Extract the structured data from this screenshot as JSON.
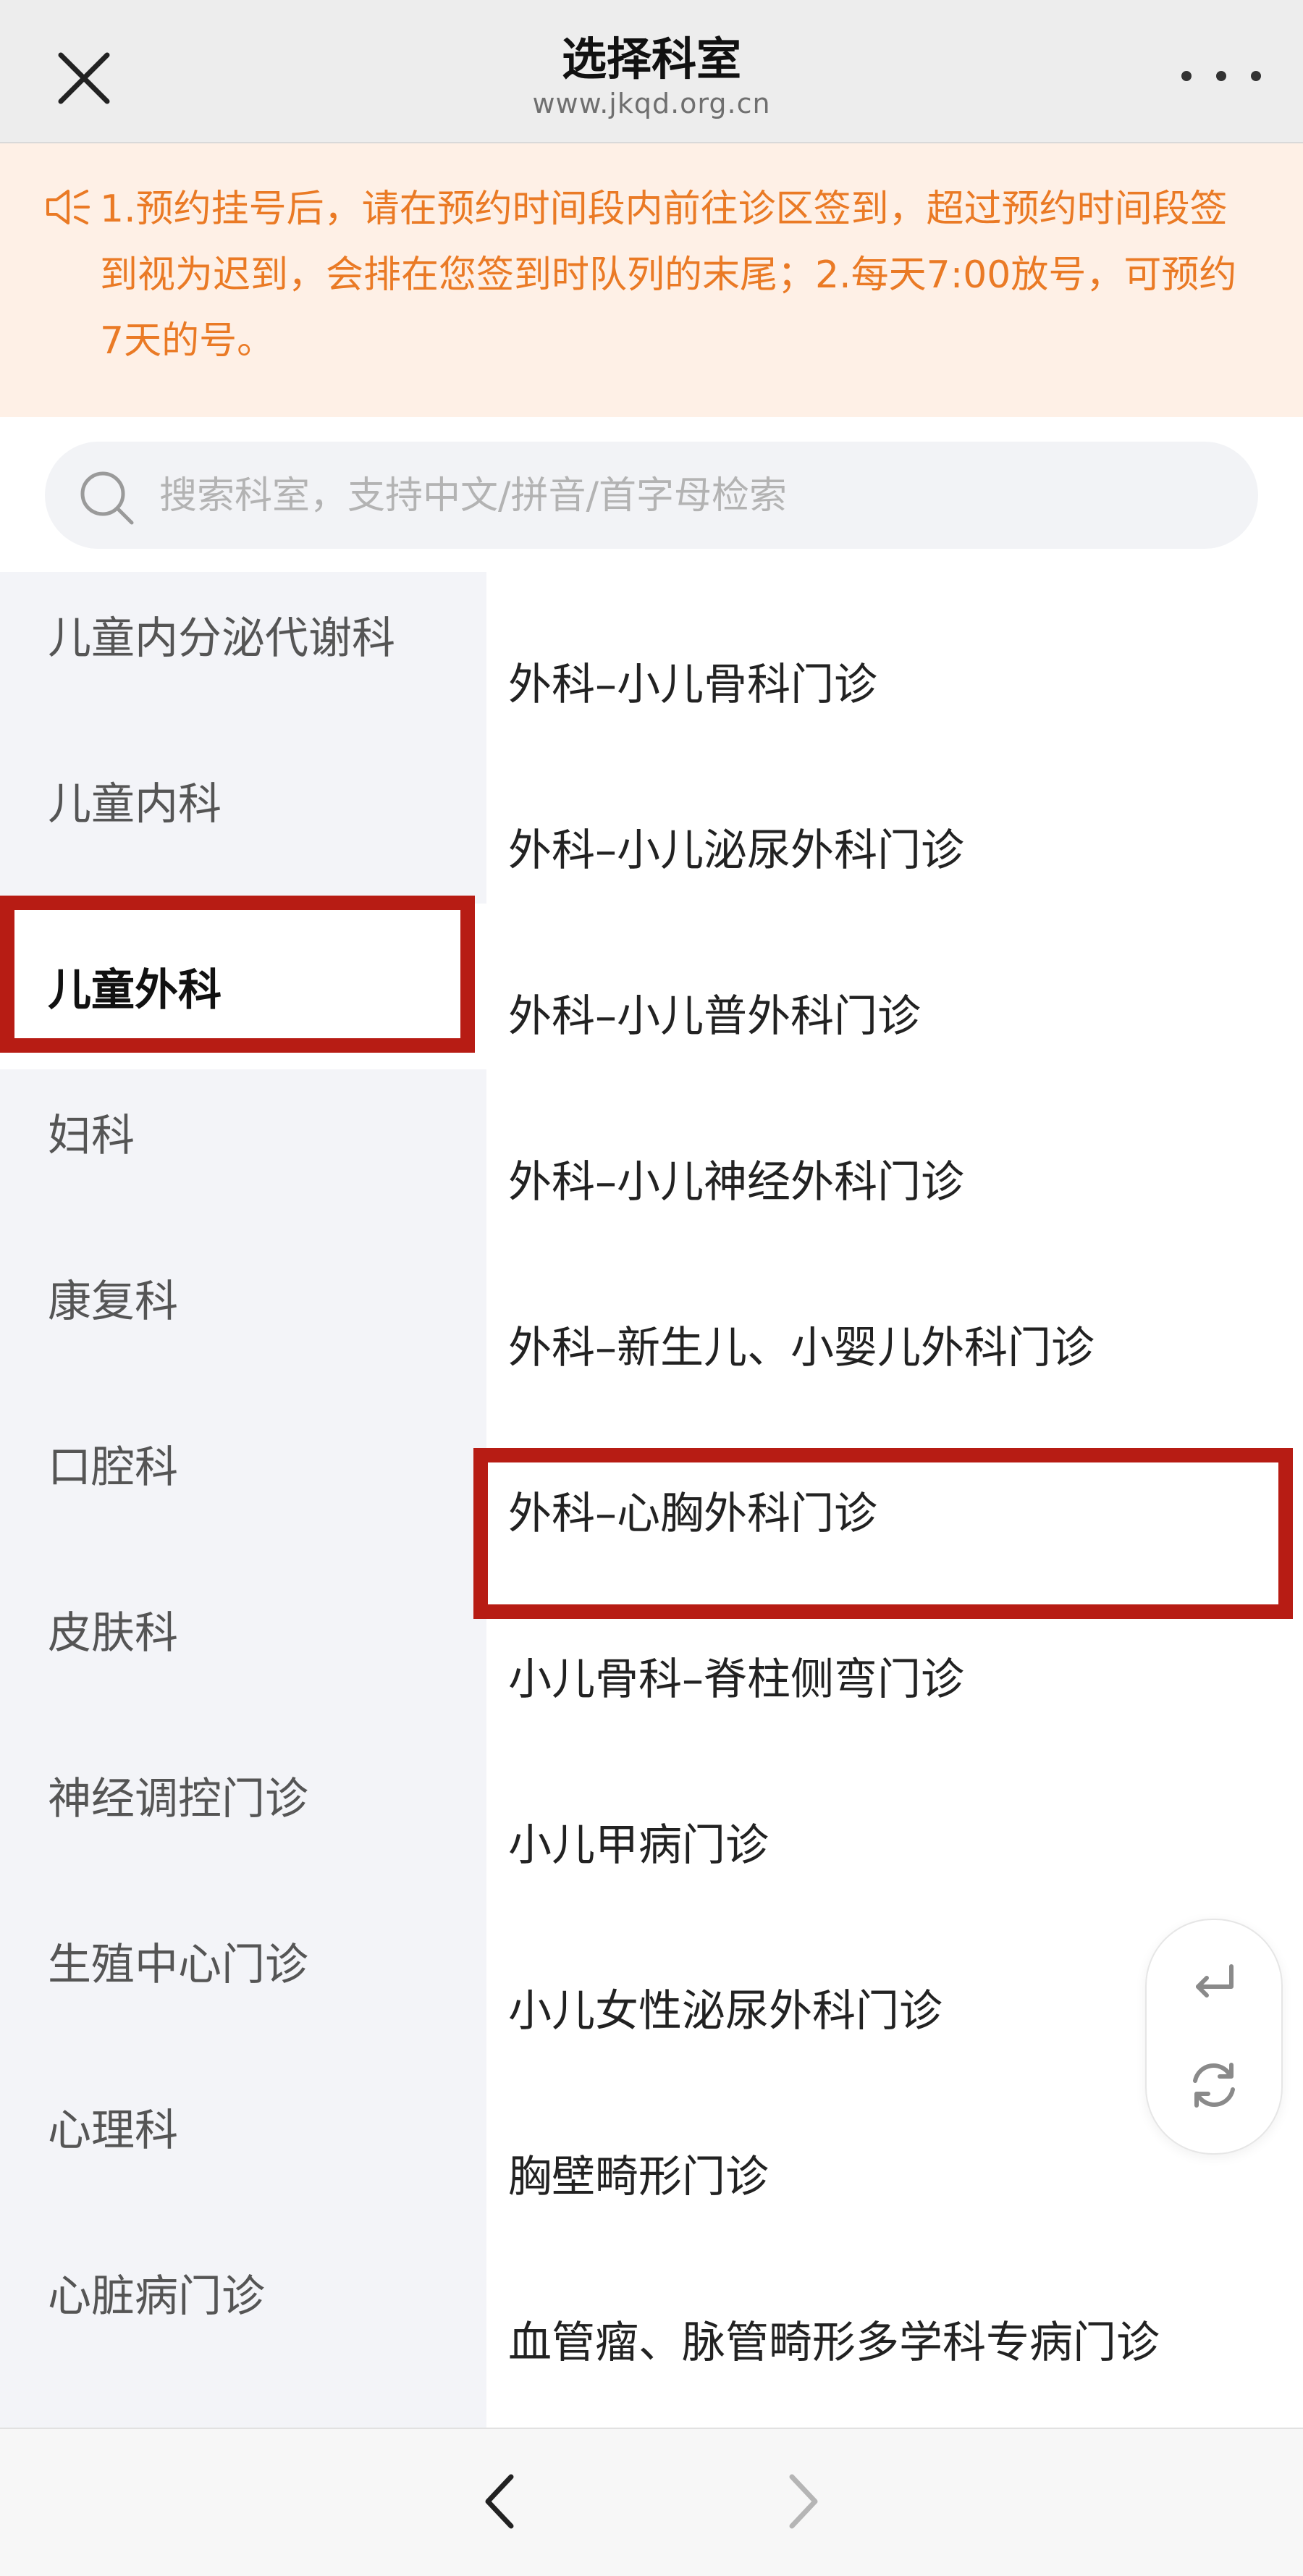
{
  "header": {
    "title": "选择科室",
    "url": "www.jkqd.org.cn",
    "close_icon": "close-icon",
    "more_icon": "more-dots-icon"
  },
  "notice": {
    "icon": "speaker-icon",
    "text": "1.预约挂号后，请在预约时间段内前往诊区签到，超过预约时间段签到视为迟到，会排在您签到时队列的末尾；2.每天7:00放号，可预约7天的号。",
    "color": "#ea7a25",
    "background": "#fef0e6"
  },
  "search": {
    "icon": "search-icon",
    "placeholder": "搜索科室，支持中文/拼音/首字母检索",
    "value": ""
  },
  "sidebar": {
    "selected": "儿童外科",
    "items": [
      {
        "label": "儿童内分泌代谢科"
      },
      {
        "label": "儿童内科"
      },
      {
        "label": "儿童外科"
      },
      {
        "label": "妇科"
      },
      {
        "label": "康复科"
      },
      {
        "label": "口腔科"
      },
      {
        "label": "皮肤科"
      },
      {
        "label": "神经调控门诊"
      },
      {
        "label": "生殖中心门诊"
      },
      {
        "label": "心理科"
      },
      {
        "label": "心脏病门诊"
      }
    ]
  },
  "departments": {
    "highlighted": "外科–心胸外科门诊",
    "items": [
      {
        "label": "外科–小儿骨科门诊"
      },
      {
        "label": "外科–小儿泌尿外科门诊"
      },
      {
        "label": "外科–小儿普外科门诊"
      },
      {
        "label": "外科–小儿神经外科门诊"
      },
      {
        "label": "外科–新生儿、小婴儿外科门诊"
      },
      {
        "label": "外科–心胸外科门诊"
      },
      {
        "label": "小儿骨科–脊柱侧弯门诊"
      },
      {
        "label": "小儿甲病门诊"
      },
      {
        "label": "小儿女性泌尿外科门诊"
      },
      {
        "label": "胸壁畸形门诊"
      },
      {
        "label": "血管瘤、脉管畸形多学科专病门诊"
      }
    ]
  },
  "floating_buttons": {
    "back_icon": "return-arrow-icon",
    "refresh_icon": "refresh-icon"
  },
  "bottom_nav": {
    "back_icon": "chevron-left-icon",
    "forward_icon": "chevron-right-icon"
  },
  "colors": {
    "highlight_border": "#b71c14",
    "sidebar_bg": "#f3f4f8",
    "header_bg": "#ededed"
  }
}
